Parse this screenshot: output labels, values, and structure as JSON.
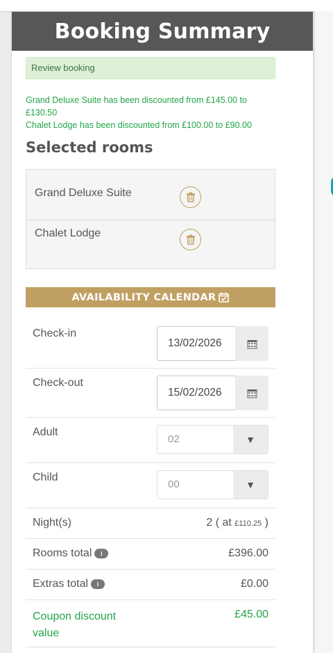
{
  "header": {
    "title": "Booking Summary"
  },
  "alert": {
    "text": "Review booking"
  },
  "discounts": [
    "Grand Deluxe Suite has been discounted from £145.00 to £130.50",
    "Chalet Lodge has been discounted from £100.00 to £90.00"
  ],
  "selected_rooms": {
    "title": "Selected rooms",
    "rooms": [
      {
        "name": "Grand Deluxe Suite",
        "delete_icon": "trash-icon"
      },
      {
        "name": "Chalet Lodge",
        "delete_icon": "trash-icon"
      }
    ]
  },
  "availability": {
    "label": "AVAILABILITY CALENDAR",
    "icon": "calendar-check-icon"
  },
  "form": {
    "checkin": {
      "label": "Check-in",
      "value": "13/02/2026"
    },
    "checkout": {
      "label": "Check-out",
      "value": "15/02/2026"
    },
    "adult": {
      "label": "Adult",
      "value": "02"
    },
    "child": {
      "label": "Child",
      "value": "00"
    }
  },
  "summary": {
    "nights": {
      "label": "Night(s)",
      "count": "2",
      "at_prefix": "( at",
      "rate": "£110.25",
      "suffix": ")"
    },
    "rooms_total": {
      "label": "Rooms total",
      "value": "£396.00"
    },
    "extras_total": {
      "label": "Extras total",
      "value": "£0.00"
    },
    "coupon": {
      "label_line1": "Coupon discount",
      "label_line2": "value",
      "value": "£45.00"
    }
  },
  "colors": {
    "header_bg": "#555759",
    "accent_gold": "#c0a062",
    "discount_green": "#22a447",
    "alert_bg": "#dff0d8"
  }
}
